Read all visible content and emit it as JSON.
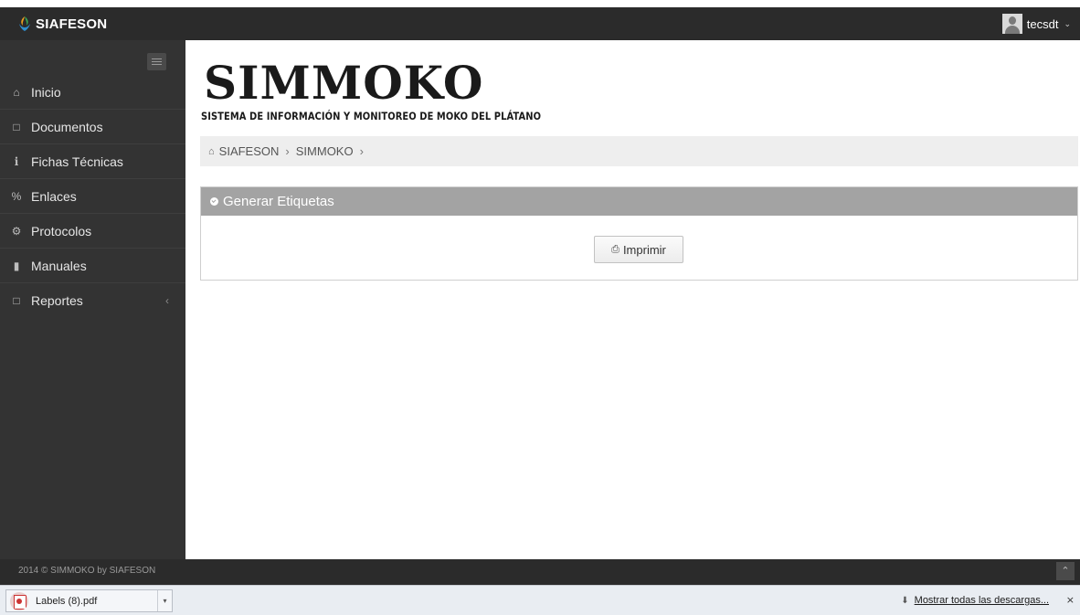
{
  "navbar": {
    "brand": "SIAFESON",
    "user": "tecsdt"
  },
  "sidebar": {
    "items": [
      {
        "label": "Inicio",
        "icon": "home-icon",
        "glyph": "⌂"
      },
      {
        "label": "Documentos",
        "icon": "folder-icon",
        "glyph": "□"
      },
      {
        "label": "Fichas Técnicas",
        "icon": "info-icon",
        "glyph": "i"
      },
      {
        "label": "Enlaces",
        "icon": "link-icon",
        "glyph": "%"
      },
      {
        "label": "Protocolos",
        "icon": "gear-icon",
        "glyph": "⚙"
      },
      {
        "label": "Manuales",
        "icon": "book-icon",
        "glyph": "▮"
      },
      {
        "label": "Reportes",
        "icon": "file-icon",
        "glyph": "□"
      }
    ]
  },
  "main": {
    "title": "SIMMOKO",
    "subtitle": "SISTEMA DE INFORMACIÓN Y MONITOREO DE MOKO DEL PLÁTANO",
    "breadcrumb": [
      "SIAFESON",
      "SIMMOKO"
    ],
    "panel": {
      "title": "Generar Etiquetas",
      "button": "Imprimir"
    }
  },
  "footer": {
    "text": "2014 © SIMMOKO by SIAFESON"
  },
  "downloads": {
    "file": "Labels (8).pdf",
    "show_all": "Mostrar todas las descargas..."
  }
}
